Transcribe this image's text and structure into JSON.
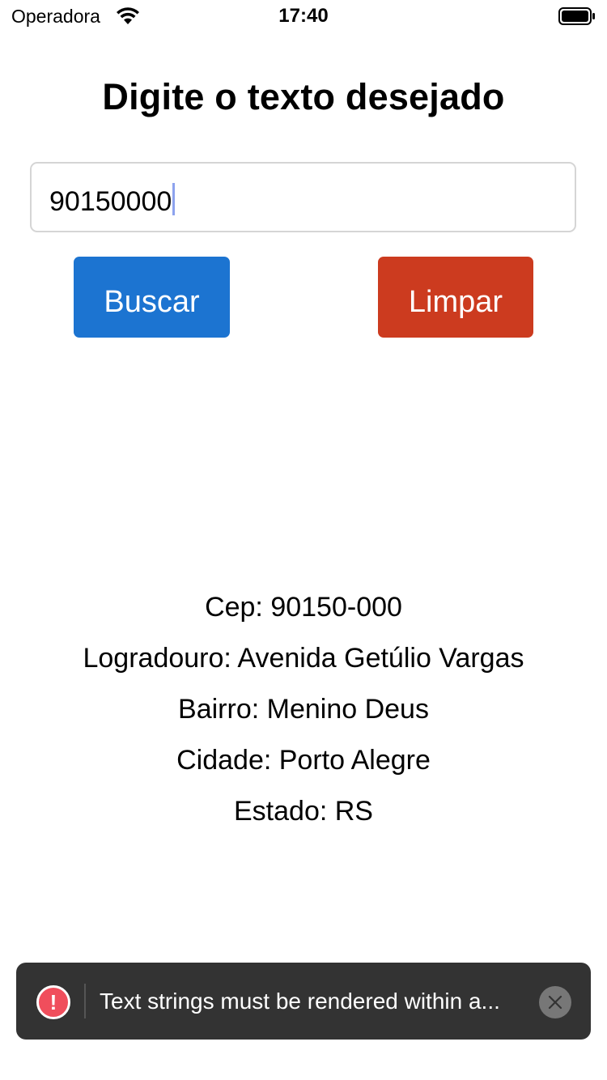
{
  "status_bar": {
    "carrier": "Operadora",
    "time": "17:40",
    "wifi_icon": "wifi-icon",
    "battery_icon": "battery-icon"
  },
  "page": {
    "title": "Digite o texto desejado"
  },
  "search": {
    "value": "90150000"
  },
  "buttons": {
    "search_label": "Buscar",
    "clear_label": "Limpar",
    "search_color": "#1c74d1",
    "clear_color": "#cc3b1f"
  },
  "result": {
    "cep": "Cep: 90150-000",
    "logradouro": "Logradouro: Avenida Getúlio Vargas",
    "bairro": "Bairro: Menino Deus",
    "cidade": "Cidade: Porto Alegre",
    "estado": "Estado: RS"
  },
  "toast": {
    "message": "Text strings must be rendered within a...",
    "error_icon": "error-icon",
    "close_icon": "close-icon",
    "error_color": "#f04e5c"
  }
}
